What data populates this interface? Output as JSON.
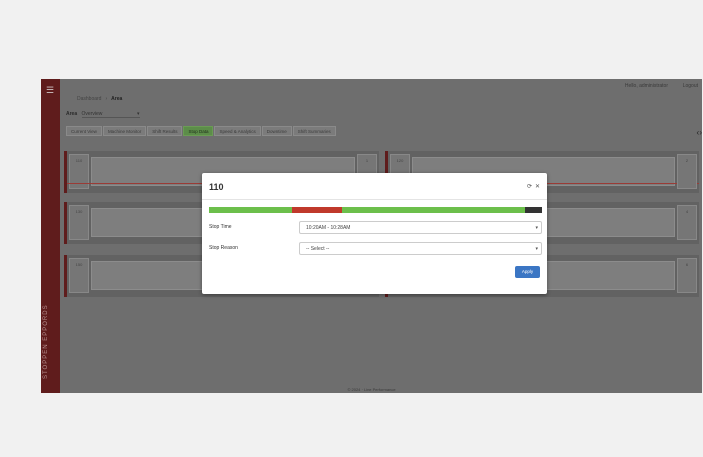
{
  "app": {
    "sidebar_brand": "STOPPEN EPPORDS",
    "user_label": "Hello, administrator",
    "logout_label": "Logout",
    "menu_icon": "hamburger-icon"
  },
  "breadcrumb": {
    "items": [
      "Dashboard",
      "Area"
    ],
    "separator": "›"
  },
  "area": {
    "label": "Area",
    "value": "Overview"
  },
  "tabs": [
    {
      "label": "Current View",
      "active": false
    },
    {
      "label": "Machine Monitor",
      "active": false
    },
    {
      "label": "Shift Results",
      "active": false
    },
    {
      "label": "Stop Data",
      "active": true
    },
    {
      "label": "Speed & Analytics",
      "active": false
    },
    {
      "label": "Downtime",
      "active": false
    },
    {
      "label": "Shift Summaries",
      "active": false
    }
  ],
  "nav_arrows": "‹ ›",
  "lanes": [
    {
      "left_cap": "110",
      "right_cap": "1"
    },
    {
      "left_cap": "130",
      "right_cap": "3"
    },
    {
      "left_cap": "150",
      "right_cap": "5"
    },
    {
      "left_cap": "120",
      "right_cap": "2"
    },
    {
      "left_cap": "140",
      "right_cap": "4"
    },
    {
      "left_cap": "160",
      "right_cap": "6"
    }
  ],
  "footer": "© 2024 · Line Performance",
  "modal": {
    "title": "110",
    "refresh_icon": "refresh-icon",
    "close_icon": "close-icon",
    "timeline_segments": [
      {
        "fraction": 0.25,
        "color": "#6cbf4b"
      },
      {
        "fraction": 0.15,
        "color": "#c0392b"
      },
      {
        "fraction": 0.55,
        "color": "#6cbf4b"
      },
      {
        "fraction": 0.05,
        "color": "#333333"
      }
    ],
    "stop_time_label": "Stop Time",
    "stop_time_value": "10:20AM - 10:28AM",
    "stop_reason_label": "Stop Reason",
    "stop_reason_value": "-- Select --",
    "apply_label": "Apply"
  },
  "colors": {
    "accent": "#3b76c4",
    "brand": "#7a1f1f",
    "running": "#6cbf4b",
    "stopped": "#c0392b"
  }
}
